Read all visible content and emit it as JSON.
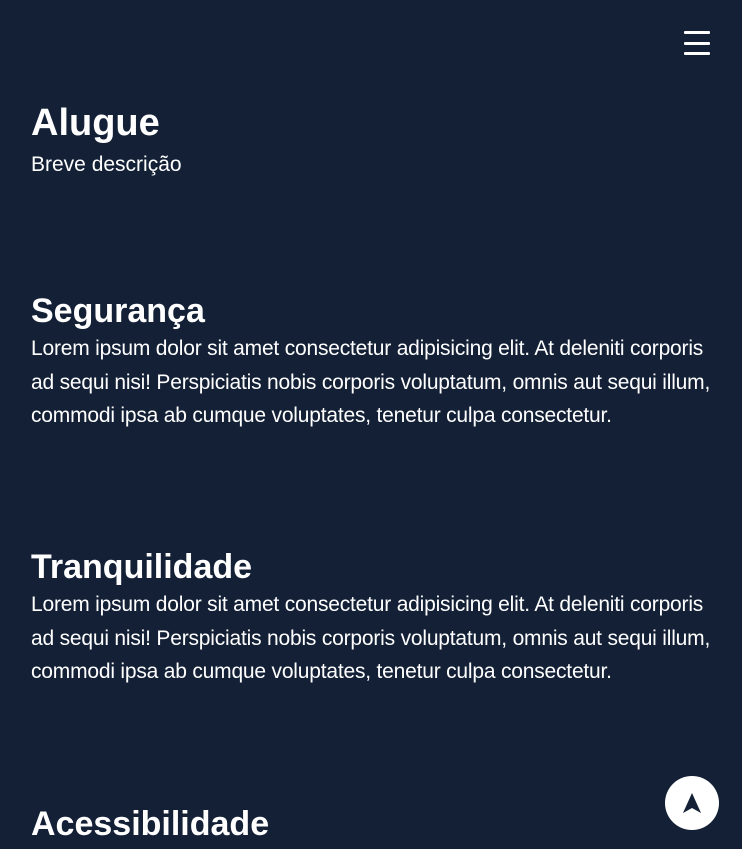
{
  "header": {
    "menu_icon": "hamburger-menu-icon"
  },
  "hero": {
    "title": "Alugue",
    "subtitle": "Breve descrição"
  },
  "features": [
    {
      "title": "Segurança",
      "text": "Lorem ipsum dolor sit amet consectetur adipisicing elit. At deleniti corporis ad sequi nisi! Perspiciatis nobis corporis voluptatum, omnis aut sequi illum, commodi ipsa ab cumque voluptates, tenetur culpa consectetur."
    },
    {
      "title": "Tranquilidade",
      "text": "Lorem ipsum dolor sit amet consectetur adipisicing elit. At deleniti corporis ad sequi nisi! Perspiciatis nobis corporis voluptatum, omnis aut sequi illum, commodi ipsa ab cumque voluptates, tenetur culpa consectetur."
    },
    {
      "title": "Acessibilidade"
    }
  ],
  "scroll_top": {
    "icon": "navigation-arrow-icon"
  },
  "colors": {
    "background": "#132036",
    "text": "#ffffff",
    "fab_background": "#ffffff",
    "fab_icon": "#132036"
  }
}
